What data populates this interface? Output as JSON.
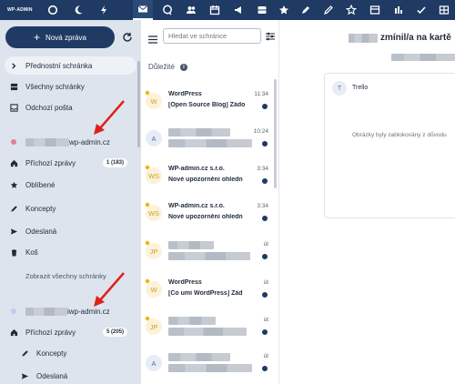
{
  "app": {
    "logo_text": "WP-ADMIN"
  },
  "sidebar": {
    "compose_label": "Nová zpráva",
    "items": [
      {
        "label": "Přednostní schránka"
      },
      {
        "label": "Všechny schránky"
      },
      {
        "label": "Odchozí pošta"
      }
    ],
    "accounts": [
      {
        "name": "wp-admin.cz",
        "color": "#e37d9a",
        "folders": [
          {
            "label": "Příchozí zprávy",
            "badge": "1 (183)"
          },
          {
            "label": "Oblíbené"
          },
          {
            "label": "Koncepty"
          },
          {
            "label": "Odeslaná"
          },
          {
            "label": "Koš"
          }
        ],
        "show_all": "Zobrazit všechny schránky"
      },
      {
        "name": "iwp-admin.cz",
        "color": "#c5cbe8",
        "folders": [
          {
            "label": "Příchozí zprávy",
            "badge": "5 (205)"
          },
          {
            "label": "Koncepty"
          },
          {
            "label": "Odeslaná"
          }
        ]
      }
    ]
  },
  "list": {
    "search_placeholder": "Hledat ve schránce",
    "section_title": "Důležité",
    "info_glyph": "i",
    "messages": [
      {
        "avatar": "W",
        "from": "WordPress",
        "time": "11:34",
        "subject": "[Open Source Blog] Žádo"
      },
      {
        "avatar": "A",
        "from": "",
        "time": "10:24",
        "subject": ""
      },
      {
        "avatar": "WS",
        "from": "WP-admin.cz s.r.o.",
        "time": "3:34",
        "subject": "Nové upozornění ohledn"
      },
      {
        "avatar": "WS",
        "from": "WP-admin.cz s.r.o.",
        "time": "3:34",
        "subject": "Nové upozornění ohledn"
      },
      {
        "avatar": "JP",
        "from": "",
        "time": "út",
        "subject": ""
      },
      {
        "avatar": "W",
        "from": "WordPress",
        "time": "út",
        "subject": "[Co umí WordPress] Žád"
      },
      {
        "avatar": "JP",
        "from": "",
        "time": "út",
        "subject": ""
      },
      {
        "avatar": "A",
        "from": "",
        "time": "út",
        "subject": ""
      }
    ]
  },
  "pane": {
    "title_suffix": "zmínil/a na kartě",
    "card_avatar": "T",
    "card_from": "Trello",
    "blocked_notice": "Obrázky byly zablokovány z důvodu"
  },
  "colors": {
    "brand": "#1f3a63",
    "sidebar_bg": "#dde4ee",
    "accent_star": "#f0b400"
  }
}
